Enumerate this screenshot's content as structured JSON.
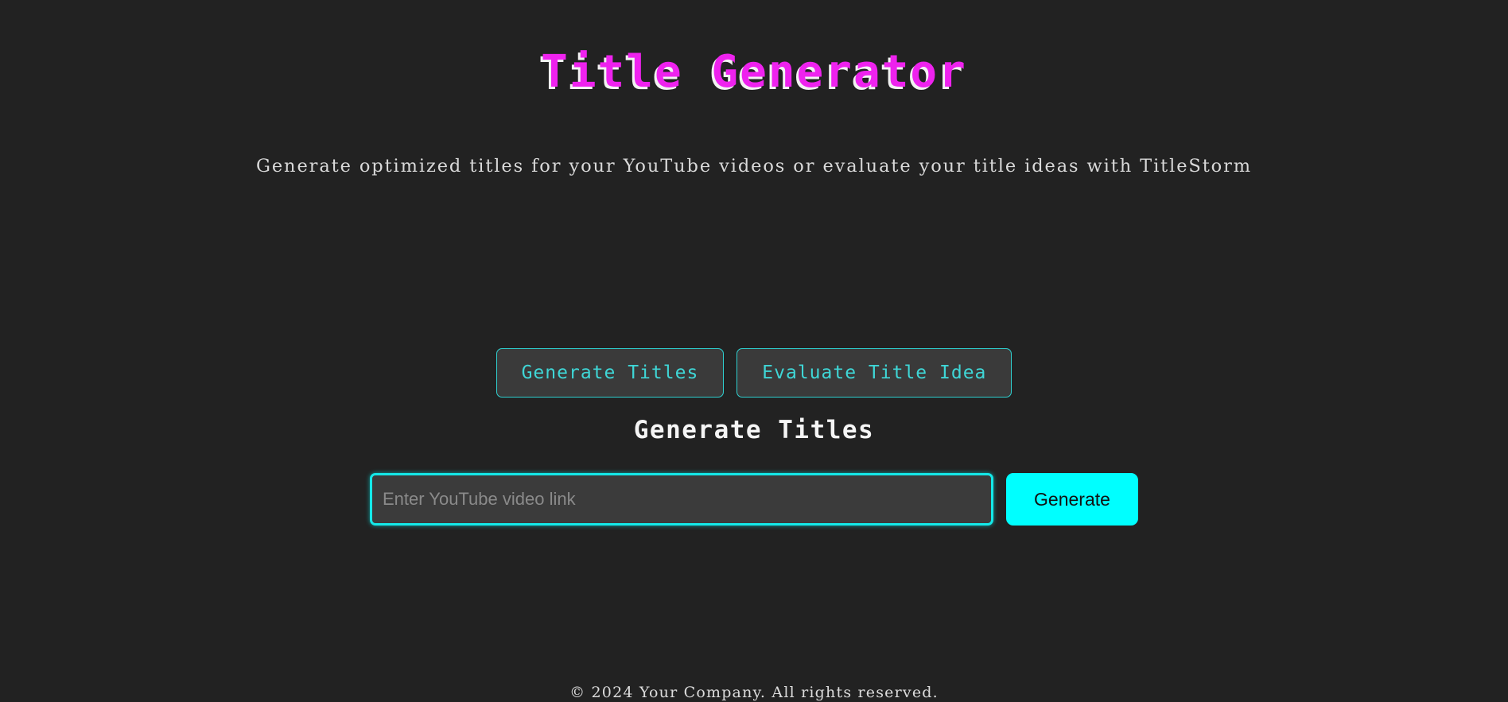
{
  "theme": {
    "background": "#222222",
    "accent_cyan": "#00FFFF",
    "accent_magenta": "#EE22EE",
    "tab_border": "#2FD0D0",
    "tab_text": "#3FD6D6",
    "tab_background": "#3A3A3A",
    "input_background": "#3B3B3B",
    "placeholder_color": "#8A8A8A"
  },
  "header": {
    "title": "Title Generator",
    "subtitle": "Generate optimized titles for your YouTube videos or evaluate your title ideas with TitleStorm"
  },
  "tabs": [
    {
      "id": "generate-titles",
      "label": "Generate Titles",
      "active": true
    },
    {
      "id": "evaluate-title-idea",
      "label": "Evaluate Title Idea",
      "active": false
    }
  ],
  "main": {
    "section_heading": "Generate Titles",
    "input": {
      "value": "",
      "placeholder": "Enter YouTube video link"
    },
    "submit_label": "Generate"
  },
  "footer": {
    "copyright": "© 2024 Your Company. All rights reserved."
  }
}
